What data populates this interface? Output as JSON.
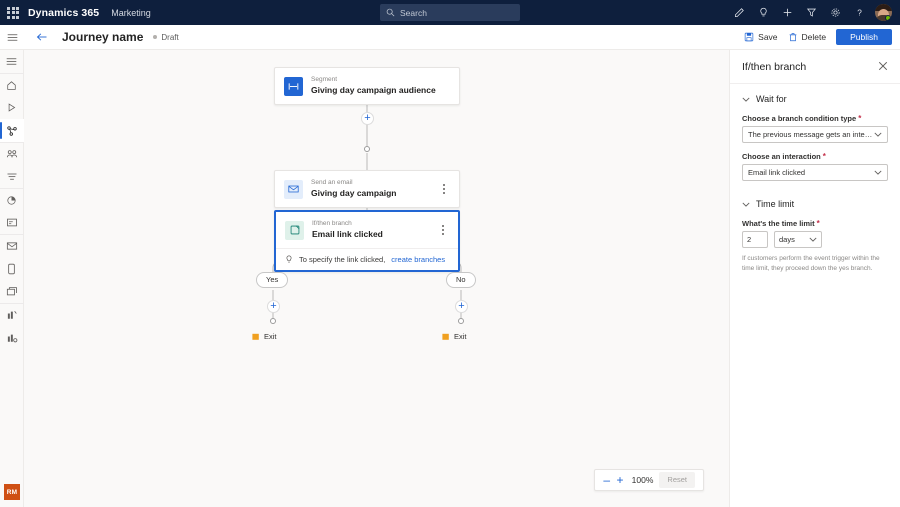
{
  "suite": {
    "brand": "Dynamics 365",
    "app_name": "Marketing",
    "search_placeholder": "Search",
    "icons": [
      {
        "name": "edit-icon"
      },
      {
        "name": "lightbulb-icon"
      },
      {
        "name": "add-icon"
      },
      {
        "name": "filter-icon"
      },
      {
        "name": "gear-icon"
      },
      {
        "name": "help-icon"
      }
    ]
  },
  "command_bar": {
    "journey_title": "Journey name",
    "status": "Draft",
    "save_label": "Save",
    "delete_label": "Delete",
    "publish_label": "Publish"
  },
  "rail": {
    "items": [
      {
        "name": "menu-icon",
        "label": "Menu"
      },
      {
        "name": "home-icon",
        "label": "Home"
      },
      {
        "name": "recent-icon",
        "label": "Recent"
      },
      {
        "name": "journeys-icon",
        "label": "Journeys",
        "active": true
      },
      {
        "name": "customers-icon",
        "label": "Customers"
      },
      {
        "name": "segments-icon",
        "label": "Segments"
      },
      {
        "name": "insights-icon",
        "label": "Insights"
      },
      {
        "name": "forms-icon",
        "label": "Forms"
      },
      {
        "name": "email-icon",
        "label": "Emails"
      },
      {
        "name": "mobile-icon",
        "label": "Text messages"
      },
      {
        "name": "push-icon",
        "label": "Push notifications"
      },
      {
        "name": "reports-icon",
        "label": "Reports"
      },
      {
        "name": "analytics-icon",
        "label": "Analytics"
      }
    ],
    "badge": "RM"
  },
  "canvas": {
    "nodes": [
      {
        "id": "segment",
        "kind": "Segment",
        "name": "Giving day campaign audience",
        "icon": "segment-icon",
        "selected": false,
        "has_kebab": false
      },
      {
        "id": "email",
        "kind": "Send an email",
        "name": "Giving day campaign",
        "icon": "email-icon",
        "selected": false,
        "has_kebab": true
      },
      {
        "id": "branch",
        "kind": "If/then branch",
        "name": "Email link clicked",
        "icon": "branch-icon",
        "selected": true,
        "has_kebab": true,
        "hint_text": "To specify the link clicked,",
        "hint_link": "create branches"
      }
    ],
    "branches": [
      {
        "pill": "Yes",
        "exit": "Exit"
      },
      {
        "pill": "No",
        "exit": "Exit"
      }
    ],
    "zoom": {
      "minus": "–",
      "plus": "+",
      "level": "100%",
      "reset": "Reset"
    }
  },
  "panel": {
    "title": "If/then branch",
    "close_icon": "close-icon",
    "sections": [
      {
        "heading": "Wait for",
        "fields": [
          {
            "label": "Choose a branch condition type",
            "required": true,
            "value": "The previous message gets an interaction"
          },
          {
            "label": "Choose an interaction",
            "required": true,
            "value": "Email link clicked"
          }
        ]
      },
      {
        "heading": "Time limit",
        "time_label": "What's the time limit",
        "time_required": true,
        "time_value": "2",
        "time_unit": "days",
        "help": "If customers perform the event trigger within the time limit, they proceed down the yes branch."
      }
    ]
  },
  "colors": {
    "accent": "#2266d3",
    "suitebar": "#0e1f3d",
    "canvas_bg": "#faf9f8",
    "exit_flag": "#f0a020",
    "badge": "#cf5014"
  }
}
